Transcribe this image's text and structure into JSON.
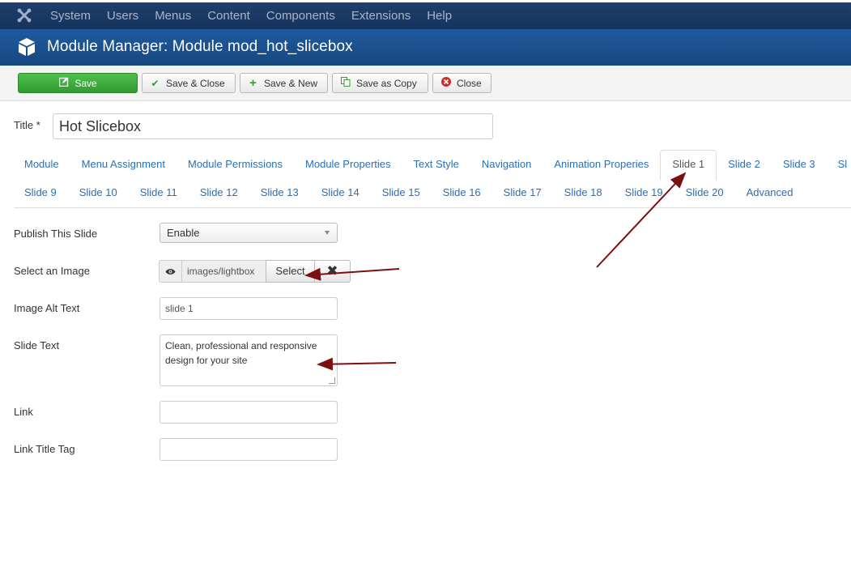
{
  "topbar": {
    "menu": [
      "System",
      "Users",
      "Menus",
      "Content",
      "Components",
      "Extensions",
      "Help"
    ]
  },
  "header": {
    "title": "Module Manager: Module mod_hot_slicebox"
  },
  "toolbar": {
    "save": "Save",
    "save_close": "Save & Close",
    "save_new": "Save & New",
    "save_copy": "Save as Copy",
    "close": "Close"
  },
  "title_field": {
    "label": "Title *",
    "value": "Hot Slicebox"
  },
  "tabs_row1": [
    "Module",
    "Menu Assignment",
    "Module Permissions",
    "Module Properties",
    "Text Style",
    "Navigation",
    "Animation Properies",
    "Slide 1",
    "Slide 2",
    "Slide 3",
    "Sl"
  ],
  "tabs_row2": [
    "Slide 9",
    "Slide 10",
    "Slide 11",
    "Slide 12",
    "Slide 13",
    "Slide 14",
    "Slide 15",
    "Slide 16",
    "Slide 17",
    "Slide 18",
    "Slide 19",
    "Slide 20",
    "Advanced"
  ],
  "active_tab": "Slide 1",
  "form": {
    "publish_label": "Publish This Slide",
    "publish_value": "Enable",
    "image_label": "Select an Image",
    "image_path": "images/lightbox",
    "image_select": "Select",
    "alt_label": "Image Alt Text",
    "alt_value": "slide 1",
    "text_label": "Slide Text",
    "text_value": "Clean, professional and responsive design for your site",
    "link_label": "Link",
    "link_value": "",
    "link_title_label": "Link Title Tag",
    "link_title_value": ""
  },
  "colors": {
    "topbar": "#1b3a66",
    "header": "#1b4f8c",
    "save_green": "#3daa3d",
    "link_blue": "#2a6fb6",
    "annotation_arrow": "#7a1010"
  }
}
